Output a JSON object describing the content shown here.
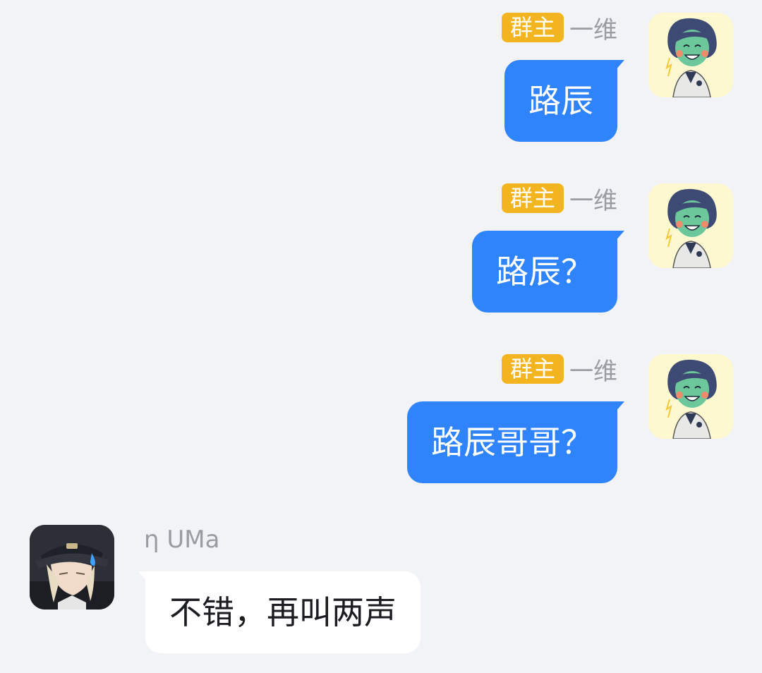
{
  "messages": [
    {
      "direction": "out",
      "badge": "群主",
      "sender": "一维",
      "text": "路辰"
    },
    {
      "direction": "out",
      "badge": "群主",
      "sender": "一维",
      "text": "路辰？"
    },
    {
      "direction": "out",
      "badge": "群主",
      "sender": "一维",
      "text": "路辰哥哥？"
    },
    {
      "direction": "in",
      "sender": "η UMa",
      "text": "不错，再叫两声"
    }
  ],
  "colors": {
    "background": "#f2f3f7",
    "badge": "#f3b51f",
    "outgoing_bubble": "#2f83fb",
    "incoming_bubble": "#ffffff",
    "sender_name": "#9a9ca3"
  }
}
